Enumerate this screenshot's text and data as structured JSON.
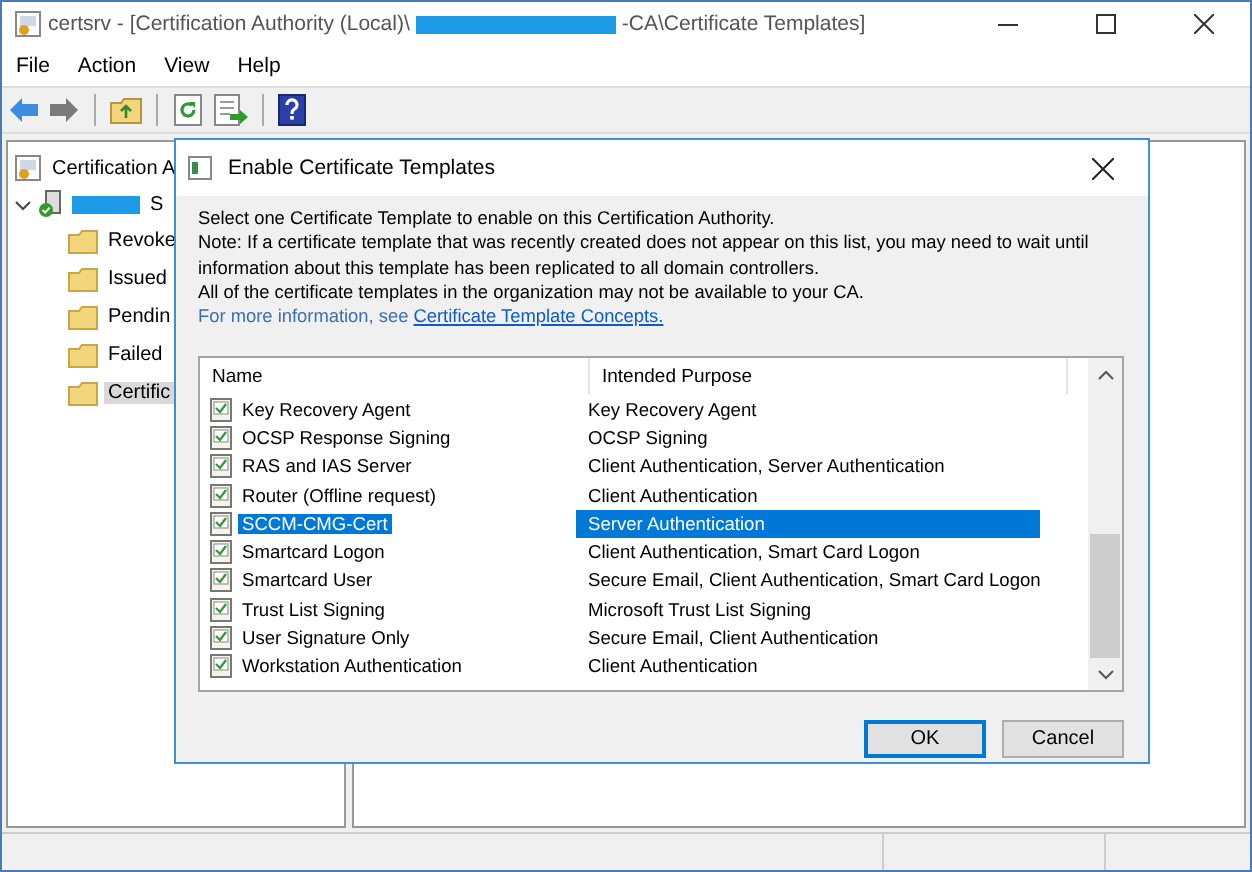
{
  "window": {
    "title_start": "certsrv - [Certification Authority (Local)\\",
    "title_end": "-CA\\Certificate Templates]"
  },
  "menu": [
    "File",
    "Action",
    "View",
    "Help"
  ],
  "tree": {
    "root": "Certification A",
    "children": [
      {
        "label": "S",
        "expanded": true,
        "children": [
          {
            "label": "Revoke",
            "selected": false
          },
          {
            "label": "Issued",
            "selected": false
          },
          {
            "label": "Pendin",
            "selected": false
          },
          {
            "label": "Failed",
            "selected": false
          },
          {
            "label": "Certific",
            "selected": true
          }
        ]
      }
    ]
  },
  "dialog": {
    "title": "Enable Certificate Templates",
    "instructions": [
      "Select one Certificate Template to enable on this Certification Authority.",
      "Note: If a certificate template that was recently created does not appear on this list, you may need to wait until",
      "information about this template has been replicated to all domain controllers.",
      "All of the certificate templates in the organization may not be available to your CA."
    ],
    "more_info": "For more information, see ",
    "link": "Certificate Template Concepts.",
    "columns": [
      "Name",
      "Intended Purpose"
    ],
    "rows": [
      {
        "name": "Key Recovery Agent",
        "purpose": "Key Recovery Agent",
        "selected": false
      },
      {
        "name": "OCSP Response Signing",
        "purpose": "OCSP Signing",
        "selected": false
      },
      {
        "name": "RAS and IAS Server",
        "purpose": "Client Authentication, Server Authentication",
        "selected": false
      },
      {
        "name": "Router (Offline request)",
        "purpose": "Client Authentication",
        "selected": false
      },
      {
        "name": "SCCM-CMG-Cert",
        "purpose": "Server Authentication",
        "selected": true
      },
      {
        "name": "Smartcard Logon",
        "purpose": "Client Authentication, Smart Card Logon",
        "selected": false
      },
      {
        "name": "Smartcard User",
        "purpose": "Secure Email, Client Authentication, Smart Card Logon",
        "selected": false
      },
      {
        "name": "Trust List Signing",
        "purpose": "Microsoft Trust List Signing",
        "selected": false
      },
      {
        "name": "User Signature Only",
        "purpose": "Secure Email, Client Authentication",
        "selected": false
      },
      {
        "name": "Workstation Authentication",
        "purpose": "Client Authentication",
        "selected": false
      }
    ],
    "buttons": [
      {
        "label": "OK",
        "default": true
      },
      {
        "label": "Cancel",
        "default": false
      }
    ]
  }
}
